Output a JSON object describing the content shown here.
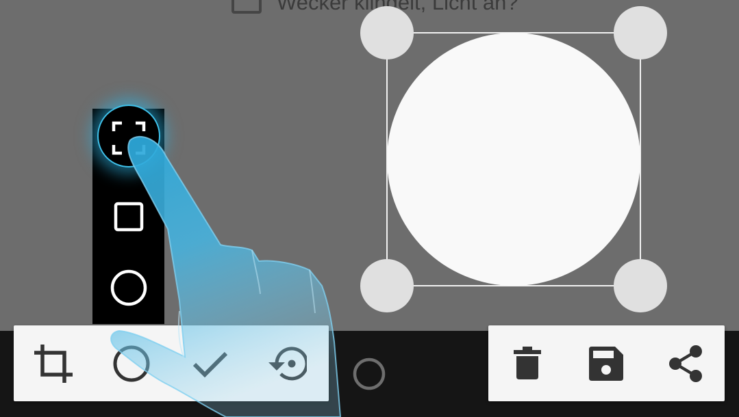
{
  "background": {
    "task_text": "Wecker klingelt, Licht an?"
  },
  "colors": {
    "canvas": "#6d6d6d",
    "bottom_bar": "#151515",
    "toolbar": "#f5f5f5",
    "icon": "#333333",
    "accent_glow": "#3fc1ea",
    "selection_circle": "#f9f9f9",
    "handle": "#e0e0e0"
  },
  "shape_selector": {
    "items": [
      {
        "icon": "free-selection-icon",
        "selected": true
      },
      {
        "icon": "square-icon",
        "selected": false
      },
      {
        "icon": "circle-icon",
        "selected": false
      }
    ]
  },
  "left_toolbar": {
    "buttons": [
      {
        "icon": "crop-icon"
      },
      {
        "icon": "circle-shape-icon"
      },
      {
        "icon": "check-icon"
      },
      {
        "icon": "restore-icon"
      }
    ]
  },
  "right_toolbar": {
    "buttons": [
      {
        "icon": "trash-icon"
      },
      {
        "icon": "save-icon"
      },
      {
        "icon": "share-icon"
      }
    ]
  },
  "floating_button": {
    "icon": "circle-outline-icon"
  },
  "overlay": {
    "icon": "tutorial-hand-icon"
  }
}
